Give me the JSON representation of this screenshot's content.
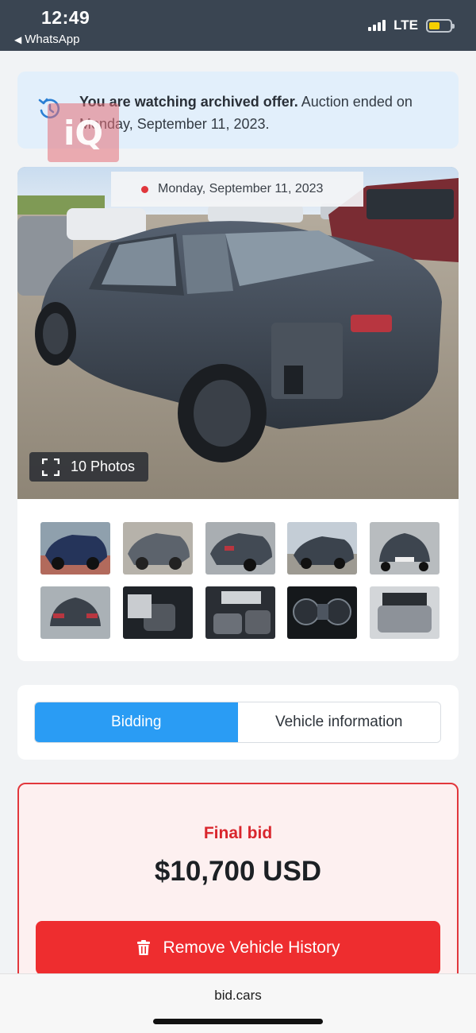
{
  "status_bar": {
    "time": "12:49",
    "back_app": "WhatsApp",
    "network": "LTE",
    "battery_color": "#f5d000"
  },
  "notice": {
    "bold_text": "You are watching archived offer.",
    "text": " Auction ended on Monday, September 11, 2023.",
    "icon": "history-icon",
    "background": "#e2effb"
  },
  "watermark": {
    "text": "iQ"
  },
  "gallery": {
    "date_label": "Monday, September 11, 2023",
    "photos_label": "10 Photos",
    "thumbnail_count": 10
  },
  "tabs": [
    {
      "label": "Bidding",
      "active": true
    },
    {
      "label": "Vehicle information",
      "active": false
    }
  ],
  "bid": {
    "label": "Final bid",
    "amount": "$10,700 USD",
    "button_label": "Remove Vehicle History",
    "accent": "#e2373c"
  },
  "browser": {
    "url": "bid.cars"
  },
  "colors": {
    "tab_active": "#2a9cf4",
    "button_red": "#ee2d2f",
    "status_bar": "#3a4552"
  }
}
